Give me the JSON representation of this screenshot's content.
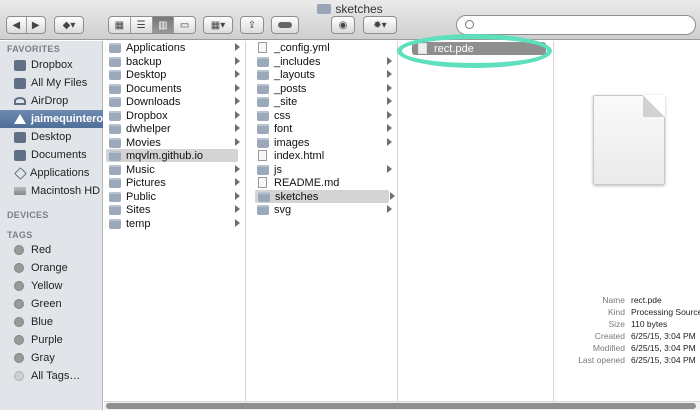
{
  "window": {
    "title": "sketches"
  },
  "toolbar": {
    "nav": [
      "◀",
      "▶"
    ],
    "view_modes": [
      "icon-view",
      "list-view",
      "column-view",
      "cover-flow"
    ],
    "search": {
      "value": "",
      "placeholder": ""
    }
  },
  "sidebar": {
    "favorites_header": "FAVORITES",
    "favorites": [
      {
        "label": "Dropbox",
        "icon": "dropbox-icon"
      },
      {
        "label": "All My Files",
        "icon": "all-files-icon"
      },
      {
        "label": "AirDrop",
        "icon": "airdrop-icon"
      },
      {
        "label": "jaimequintero",
        "icon": "home-icon",
        "selected": true
      },
      {
        "label": "Desktop",
        "icon": "desktop-icon"
      },
      {
        "label": "Documents",
        "icon": "documents-icon"
      },
      {
        "label": "Applications",
        "icon": "applications-icon"
      },
      {
        "label": "Macintosh HD",
        "icon": "hard-drive-icon"
      }
    ],
    "devices_header": "DEVICES",
    "tags_header": "TAGS",
    "tags": [
      {
        "label": "Red",
        "color": "#9a9a9a"
      },
      {
        "label": "Orange",
        "color": "#9a9a9a"
      },
      {
        "label": "Yellow",
        "color": "#9a9a9a"
      },
      {
        "label": "Green",
        "color": "#9a9a9a"
      },
      {
        "label": "Blue",
        "color": "#9a9a9a"
      },
      {
        "label": "Purple",
        "color": "#9a9a9a"
      },
      {
        "label": "Gray",
        "color": "#9a9a9a"
      },
      {
        "label": "All Tags…",
        "color": "#d0d0d0"
      }
    ]
  },
  "columns": [
    {
      "items": [
        {
          "label": "Applications",
          "type": "folder"
        },
        {
          "label": "backup",
          "type": "folder"
        },
        {
          "label": "Desktop",
          "type": "folder"
        },
        {
          "label": "Documents",
          "type": "folder"
        },
        {
          "label": "Downloads",
          "type": "folder"
        },
        {
          "label": "Dropbox",
          "type": "folder"
        },
        {
          "label": "dwhelper",
          "type": "folder"
        },
        {
          "label": "Movies",
          "type": "folder"
        },
        {
          "label": "mqvlm.github.io",
          "type": "folder",
          "selected": true
        },
        {
          "label": "Music",
          "type": "folder"
        },
        {
          "label": "Pictures",
          "type": "folder"
        },
        {
          "label": "Public",
          "type": "folder"
        },
        {
          "label": "Sites",
          "type": "folder"
        },
        {
          "label": "temp",
          "type": "folder"
        }
      ]
    },
    {
      "items": [
        {
          "label": "_config.yml",
          "type": "file"
        },
        {
          "label": "_includes",
          "type": "folder"
        },
        {
          "label": "_layouts",
          "type": "folder"
        },
        {
          "label": "_posts",
          "type": "folder"
        },
        {
          "label": "_site",
          "type": "folder"
        },
        {
          "label": "css",
          "type": "folder"
        },
        {
          "label": "font",
          "type": "folder"
        },
        {
          "label": "images",
          "type": "folder"
        },
        {
          "label": "index.html",
          "type": "file"
        },
        {
          "label": "js",
          "type": "folder"
        },
        {
          "label": "README.md",
          "type": "file"
        },
        {
          "label": "sketches",
          "type": "folder",
          "selected": true
        },
        {
          "label": "svg",
          "type": "folder"
        }
      ]
    },
    {
      "items": [
        {
          "label": "rect.pde",
          "type": "file",
          "active": true
        }
      ]
    }
  ],
  "preview": {
    "info": [
      {
        "key": "Name",
        "value": "rect.pde"
      },
      {
        "key": "Kind",
        "value": "Processing Source"
      },
      {
        "key": "Size",
        "value": "110 bytes"
      },
      {
        "key": "Created",
        "value": "6/25/15, 3:04 PM"
      },
      {
        "key": "Modified",
        "value": "6/25/15, 3:04 PM"
      },
      {
        "key": "Last opened",
        "value": "6/25/15, 3:04 PM"
      }
    ]
  },
  "annotation_color": "#5ee0bd"
}
